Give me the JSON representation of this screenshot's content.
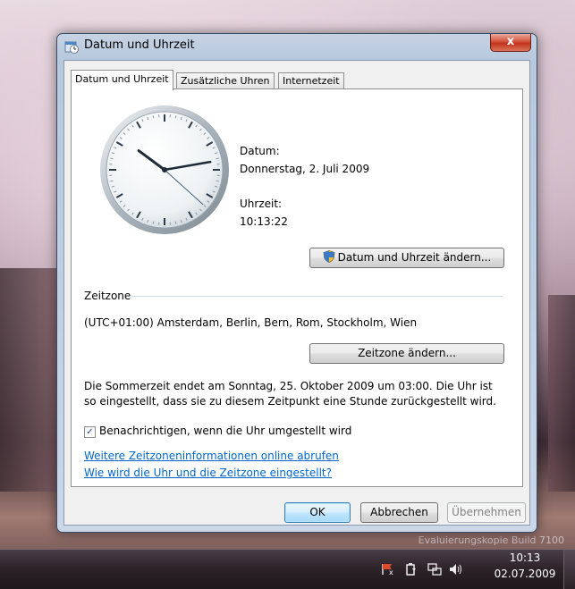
{
  "desktop": {
    "watermark": "Evaluierungskopie Build 7100"
  },
  "window": {
    "title": "Datum und Uhrzeit",
    "close_label": "x"
  },
  "tabs": [
    {
      "label": "Datum und Uhrzeit",
      "active": true
    },
    {
      "label": "Zusätzliche Uhren",
      "active": false
    },
    {
      "label": "Internetzeit",
      "active": false
    }
  ],
  "clock": {
    "hours": 10,
    "minutes": 13,
    "seconds": 22
  },
  "datetime": {
    "date_label": "Datum:",
    "date_value": "Donnerstag, 2. Juli 2009",
    "time_label": "Uhrzeit:",
    "time_value": "10:13:22",
    "change_button": "Datum und Uhrzeit ändern..."
  },
  "timezone": {
    "section_label": "Zeitzone",
    "value": "(UTC+01:00) Amsterdam, Berlin, Bern, Rom, Stockholm, Wien",
    "change_button": "Zeitzone ändern...",
    "dst_line1": "Die Sommerzeit endet am Sonntag, 25. Oktober 2009 um 03:00. Die Uhr ist",
    "dst_line2": "so eingestellt, dass sie zu diesem Zeitpunkt eine Stunde zurückgestellt wird.",
    "notify_checkbox": {
      "label": "Benachrichtigen, wenn die Uhr umgestellt wird",
      "checked": true
    },
    "link_more": "Weitere Zeitzoneninformationen online abrufen",
    "link_howto": "Wie wird die Uhr und die Zeitzone eingestellt?"
  },
  "footer": {
    "ok": "OK",
    "cancel": "Abbrechen",
    "apply": "Übernehmen"
  },
  "taskbar": {
    "time": "10:13",
    "date": "02.07.2009",
    "icons": [
      "action-center-flag-icon",
      "power-icon",
      "network-icon",
      "volume-icon"
    ]
  },
  "colors": {
    "link": "#0066cc",
    "close": "#c4321c",
    "default_button": "#3c7fb1"
  }
}
